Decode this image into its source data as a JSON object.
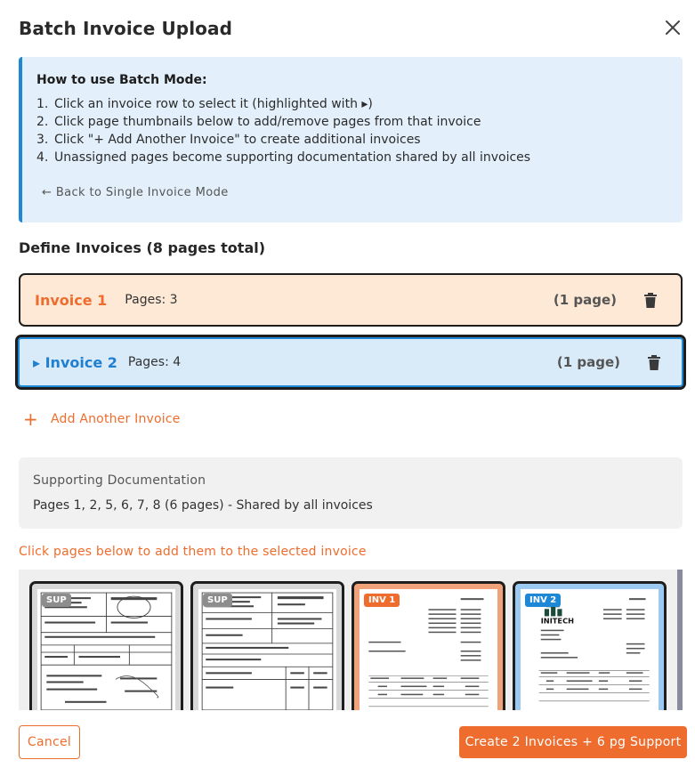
{
  "dialog": {
    "title": "Batch Invoice Upload",
    "close_icon": "close-icon"
  },
  "info": {
    "title": "How to use Batch Mode:",
    "steps": [
      {
        "num": "1.",
        "text": "Click an invoice row to select it (highlighted with ▸)"
      },
      {
        "num": "2.",
        "text": "Click page thumbnails below to add/remove pages from that invoice"
      },
      {
        "num": "3.",
        "text": "Click \"+ Add Another Invoice\" to create additional invoices"
      },
      {
        "num": "4.",
        "text": "Unassigned pages become supporting documentation shared by all invoices"
      }
    ],
    "back_link": "← Back to Single Invoice Mode"
  },
  "invoices": {
    "section_title": "Define Invoices (8 pages total)",
    "rows": [
      {
        "name": "Invoice 1",
        "pages": "Pages: 3",
        "count": "(1 page)",
        "selected": false
      },
      {
        "name": "▸ Invoice 2",
        "pages": "Pages: 4",
        "count": "(1 page)",
        "selected": true
      }
    ],
    "add_label": "Add Another Invoice",
    "add_icon": "plus-icon"
  },
  "support": {
    "title": "Supporting Documentation",
    "text": "Pages 1, 2, 5, 6, 7, 8 (6 pages) - Shared by all invoices"
  },
  "hint": "Click pages below to add them to the selected invoice",
  "thumbnails": [
    {
      "badge": "SUP",
      "kind": "sup"
    },
    {
      "badge": "SUP",
      "kind": "sup"
    },
    {
      "badge": "INV 1",
      "kind": "inv1"
    },
    {
      "badge": "INV 2",
      "kind": "inv2",
      "logo_text": "INITECH"
    }
  ],
  "footer": {
    "cancel": "Cancel",
    "create": "Create 2 Invoices + 6 pg Support"
  },
  "colors": {
    "accent": "#ee6d2e",
    "selected": "#1f88d6",
    "info_bg": "#e3f0fb",
    "inv1_bg": "#fde9d5",
    "inv2_bg": "#d9eaf9"
  }
}
